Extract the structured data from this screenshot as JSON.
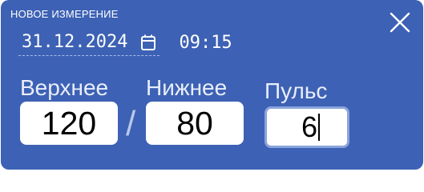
{
  "dialog": {
    "title": "НОВОЕ ИЗМЕРЕНИЕ",
    "date": "31.12.2024",
    "time": "09:15"
  },
  "fields": {
    "systolic": {
      "label": "Верхнее",
      "value": "120"
    },
    "diastolic": {
      "label": "Нижнее",
      "value": "80"
    },
    "pulse": {
      "label": "Пульс",
      "value": "6"
    },
    "separator": "/"
  },
  "icons": {
    "close": "close-icon",
    "calendar": "calendar-icon"
  },
  "colors": {
    "background": "#3d61b4",
    "input_background": "#ffffff",
    "active_border": "#8aa4dc"
  }
}
